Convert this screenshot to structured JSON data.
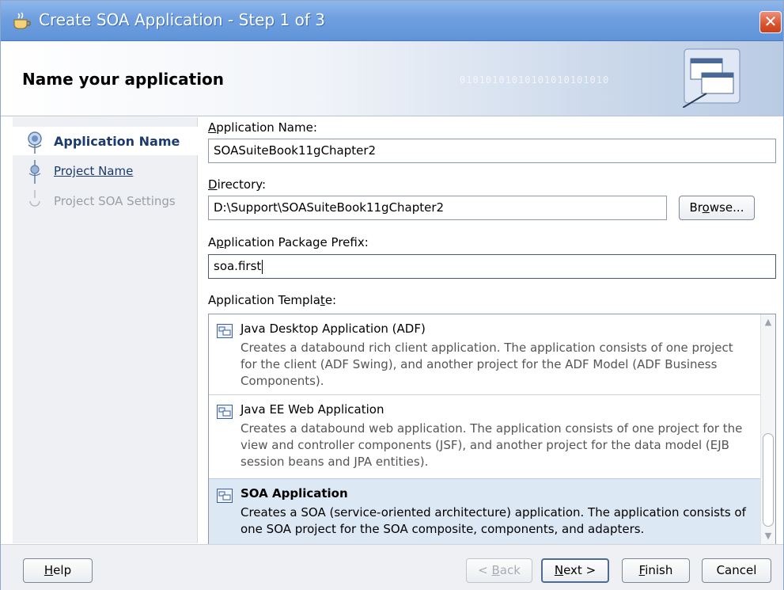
{
  "window": {
    "title": "Create SOA Application - Step 1 of 3",
    "close_label": "✕"
  },
  "header": {
    "title": "Name your application",
    "binary_text": "01010101010101010101010"
  },
  "steps": [
    {
      "label": "Application Name",
      "state": "active"
    },
    {
      "label": "Project Name",
      "state": "link"
    },
    {
      "label": "Project SOA Settings",
      "state": "disabled"
    }
  ],
  "form": {
    "app_name": {
      "label_pre": "",
      "label_mnemonic": "A",
      "label_post": "pplication Name:",
      "value": "SOASuiteBook11gChapter2"
    },
    "directory": {
      "label_pre": "",
      "label_mnemonic": "D",
      "label_post": "irectory:",
      "value": "D:\\Support\\SOASuiteBook11gChapter2"
    },
    "browse_button": {
      "pre": "Br",
      "mnemonic": "o",
      "post": "wse..."
    },
    "package_prefix": {
      "label_pre": "A",
      "label_mnemonic": "p",
      "label_post": "plication Package Prefix:",
      "value": "soa.first"
    },
    "template": {
      "label_pre": "Application Templa",
      "label_mnemonic": "t",
      "label_post": "e:"
    }
  },
  "templates": [
    {
      "title": "Java Desktop Application (ADF)",
      "description": "Creates a databound rich client application. The application consists of one project for the client (ADF Swing), and another project for the ADF Model (ADF Business Components).",
      "selected": false
    },
    {
      "title": "Java EE Web Application",
      "description": "Creates a databound web application. The application consists of one project for the view and controller components (JSF), and another project for the data model (EJB session beans and JPA entities).",
      "selected": false
    },
    {
      "title": "SOA Application",
      "description": "Creates a SOA (service-oriented architecture) application. The application consists of one SOA project for the SOA composite, components, and adapters.",
      "selected": true
    }
  ],
  "footer": {
    "help": {
      "pre": "",
      "mnemonic": "H",
      "post": "elp"
    },
    "back": {
      "pre": "< ",
      "mnemonic": "B",
      "post": "ack"
    },
    "next": {
      "pre": "",
      "mnemonic": "N",
      "post": "ext >"
    },
    "finish": {
      "pre": "",
      "mnemonic": "F",
      "post": "inish"
    },
    "cancel": {
      "pre": "Cancel",
      "mnemonic": "",
      "post": ""
    }
  },
  "colors": {
    "titlebar": "#6f9fe0",
    "selection": "#dde8f5",
    "link": "#1c3a6d"
  }
}
